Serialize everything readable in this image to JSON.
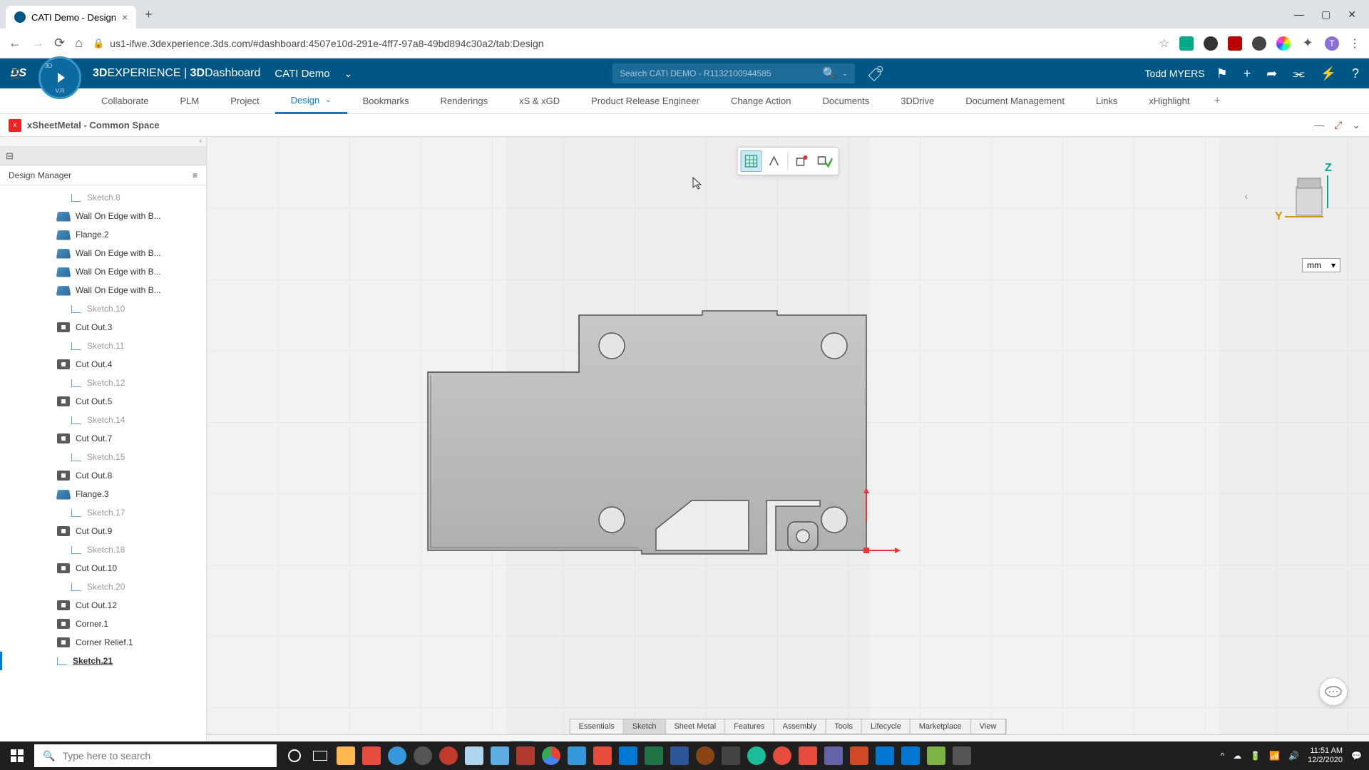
{
  "browser": {
    "tab_title": "CATI Demo - Design",
    "url": "us1-ifwe.3dexperience.3ds.com/#dashboard:4507e10d-291e-4ff7-97a8-49bd894c30a2/tab:Design"
  },
  "header": {
    "brand_bold": "3D",
    "brand_rest": "EXPERIENCE | ",
    "brand_dash_bold": "3D",
    "brand_dash_rest": "Dashboard",
    "context": "CATI Demo",
    "search_placeholder": "Search CATI DEMO - R1132100944585",
    "user": "Todd MYERS"
  },
  "nav_tabs": [
    "Collaborate",
    "PLM",
    "Project",
    "Design",
    "Bookmarks",
    "Renderings",
    "xS & xGD",
    "Product Release Engineer",
    "Change Action",
    "Documents",
    "3DDrive",
    "Document Management",
    "Links",
    "xHighlight"
  ],
  "nav_active": "Design",
  "sub_header": {
    "title": "xSheetMetal - Common Space"
  },
  "sidebar": {
    "header": "Design Manager",
    "items": [
      {
        "label": "Sketch.8",
        "icon": "sketch",
        "gray": true
      },
      {
        "label": "Wall On Edge with B...",
        "icon": "feature"
      },
      {
        "label": "Flange.2",
        "icon": "feature"
      },
      {
        "label": "Wall On Edge with B...",
        "icon": "feature"
      },
      {
        "label": "Wall On Edge with B...",
        "icon": "feature"
      },
      {
        "label": "Wall On Edge with B...",
        "icon": "feature"
      },
      {
        "label": "Sketch.10",
        "icon": "sketch",
        "gray": true
      },
      {
        "label": "Cut Out.3",
        "icon": "cutout"
      },
      {
        "label": "Sketch.11",
        "icon": "sketch",
        "gray": true
      },
      {
        "label": "Cut Out.4",
        "icon": "cutout"
      },
      {
        "label": "Sketch.12",
        "icon": "sketch",
        "gray": true
      },
      {
        "label": "Cut Out.5",
        "icon": "cutout"
      },
      {
        "label": "Sketch.14",
        "icon": "sketch",
        "gray": true
      },
      {
        "label": "Cut Out.7",
        "icon": "cutout"
      },
      {
        "label": "Sketch.15",
        "icon": "sketch",
        "gray": true
      },
      {
        "label": "Cut Out.8",
        "icon": "cutout"
      },
      {
        "label": "Flange.3",
        "icon": "feature"
      },
      {
        "label": "Sketch.17",
        "icon": "sketch",
        "gray": true
      },
      {
        "label": "Cut Out.9",
        "icon": "cutout"
      },
      {
        "label": "Sketch.18",
        "icon": "sketch",
        "gray": true
      },
      {
        "label": "Cut Out.10",
        "icon": "cutout"
      },
      {
        "label": "Sketch.20",
        "icon": "sketch",
        "gray": true
      },
      {
        "label": "Cut Out.12",
        "icon": "cutout"
      },
      {
        "label": "Corner.1",
        "icon": "cutout"
      },
      {
        "label": "Corner Relief.1",
        "icon": "cutout"
      },
      {
        "label": "Sketch.21",
        "icon": "sketch",
        "selected": true
      }
    ]
  },
  "viewport": {
    "unit": "mm",
    "axes": {
      "z": "Z",
      "y": "Y"
    }
  },
  "bottom_tabs": [
    "Essentials",
    "Sketch",
    "Sheet Metal",
    "Features",
    "Assembly",
    "Tools",
    "Lifecycle",
    "Marketplace",
    "View"
  ],
  "bottom_tab_active": "Sketch",
  "taskbar": {
    "search_placeholder": "Type here to search",
    "time": "11:51 AM",
    "date": "12/2/2020"
  },
  "colors": {
    "primary": "#005685",
    "accent": "#0078d4"
  }
}
